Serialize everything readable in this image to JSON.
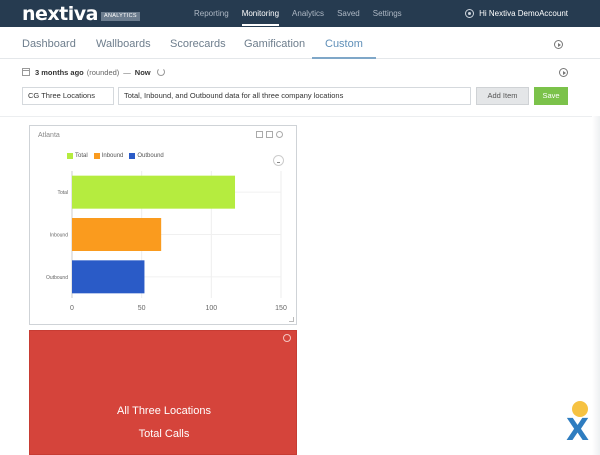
{
  "topbar": {
    "logo": "nextiva",
    "logo_badge": "ANALYTICS",
    "nav": [
      "Reporting",
      "Monitoring",
      "Analytics",
      "Saved",
      "Settings"
    ],
    "active_nav": "Monitoring",
    "user_greeting": "Hi Nextiva DemoAccount"
  },
  "tabs": {
    "items": [
      "Dashboard",
      "Wallboards",
      "Scorecards",
      "Gamification",
      "Custom"
    ],
    "active": "Custom"
  },
  "date_filter": {
    "range": "3 months ago",
    "rounded": "(rounded)",
    "separator": "—",
    "end": "Now"
  },
  "dashboard_form": {
    "name_value": "CG Three Locations",
    "description_value": "Total, Inbound, and Outbound data for all three company locations",
    "add_item_label": "Add Item",
    "save_label": "Save"
  },
  "widget_chart": {
    "title": "Atlanta"
  },
  "chart_data": {
    "type": "bar",
    "orientation": "horizontal",
    "categories": [
      "Total",
      "Inbound",
      "Outbound"
    ],
    "values": [
      117,
      64,
      52
    ],
    "colors": [
      "#b5ec3f",
      "#fa9b1e",
      "#2a5bc7"
    ],
    "legend": [
      "Total",
      "Inbound",
      "Outbound"
    ],
    "legend_position": "top-left",
    "xlim": [
      0,
      150
    ],
    "xticks": [
      "0",
      "50",
      "100",
      "150"
    ],
    "grid": true
  },
  "widget_summary": {
    "title": "All Three Locations",
    "subtitle": "Total Calls",
    "background": "#d5443b"
  },
  "colors": {
    "topbar": "#263b50",
    "accent_tab": "#5f8fb8",
    "save_green": "#7bc24a"
  }
}
